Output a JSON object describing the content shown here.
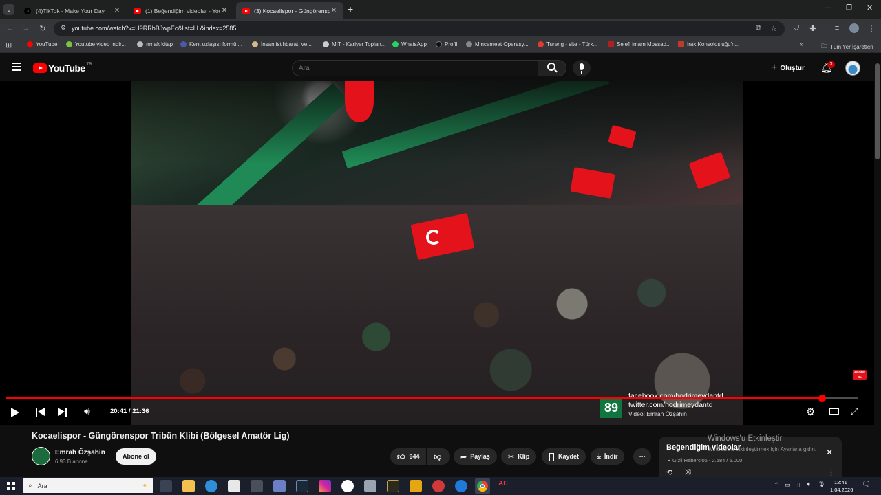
{
  "browser": {
    "tabs": [
      {
        "title": "(4)TikTok - Make Your Day",
        "icon": "tiktok-icon",
        "active": false
      },
      {
        "title": "(1) Beğendiğim videolar - YouT",
        "icon": "youtube-icon",
        "active": false
      },
      {
        "title": "(3) Kocaelispor - Güngörenspor",
        "icon": "youtube-icon",
        "active": true
      }
    ],
    "new_tab": "+",
    "url": "youtube.com/watch?v=U9RRbBJwpEc&list=LL&index=2585",
    "bookmarks": [
      {
        "label": "YouTube",
        "color": "#ff0000"
      },
      {
        "label": "Youtube video indir...",
        "color": "#7cc242"
      },
      {
        "label": "ırmak kitap",
        "color": "#bbbbbb"
      },
      {
        "label": "Kent uzlaşısı formül...",
        "color": "#4a5aa8"
      },
      {
        "label": "İnsan istihbaratı ve...",
        "color": "#d4b98c"
      },
      {
        "label": "MİT - Kariyer Toplan...",
        "color": "#cccccc"
      },
      {
        "label": "WhatsApp",
        "color": "#25d366"
      },
      {
        "label": "Profil",
        "color": "#111111"
      },
      {
        "label": "Mincemeat Operasy...",
        "color": "#888888"
      },
      {
        "label": "Tureng - site - Türk...",
        "color": "#e33b2e"
      },
      {
        "label": "Selefi imam Mossad...",
        "color": "#b02020"
      },
      {
        "label": "Irak Konsolosluğu'n...",
        "color": "#c0392b"
      }
    ],
    "all_bookmarks": "Tüm Yer İşaretleri"
  },
  "youtube": {
    "logo_text": "YouTube",
    "logo_country": "TR",
    "search_placeholder": "Ara",
    "create_label": "Oluştur",
    "notification_count": "3"
  },
  "player": {
    "time": "20:41 / 21:36",
    "progress_fraction": 0.958,
    "overlay_number": "89",
    "overlay_line1": "facebook.com/hodrimeydantd",
    "overlay_line2": "twitter.com/hodrimeydantd",
    "overlay_line3": "Video: Emrah Özşahin",
    "corner_badge": "ABONE OL"
  },
  "video": {
    "title": "Kocaelispor - Güngörenspor Tribün Klibi (Bölgesel Amatör Lig)",
    "channel": "Emrah Özşahin",
    "subscribers": "6,93 B abone",
    "subscribe_label": "Abone ol",
    "likes": "944",
    "share_label": "Paylaş",
    "clip_label": "Klip",
    "save_label": "Kaydet",
    "download_label": "İndir",
    "more_label": "⋯"
  },
  "playlist": {
    "title": "Beğendiğim videolar",
    "meta": "Gizli  Haberci06 - 2.584 / 5.000"
  },
  "watermark": {
    "line1": "Windows'u Etkinleştir",
    "line2": "Windows'u etkinleştirmek için Ayarlar'a gidin."
  },
  "taskbar": {
    "search_placeholder": "Ara",
    "time": "12:41",
    "date": "1.04.2026"
  },
  "colors": {
    "yt_red": "#ff0000",
    "bg": "#0f0f0f",
    "banner_green": "#1f8a55",
    "flag_red": "#e3121b"
  }
}
